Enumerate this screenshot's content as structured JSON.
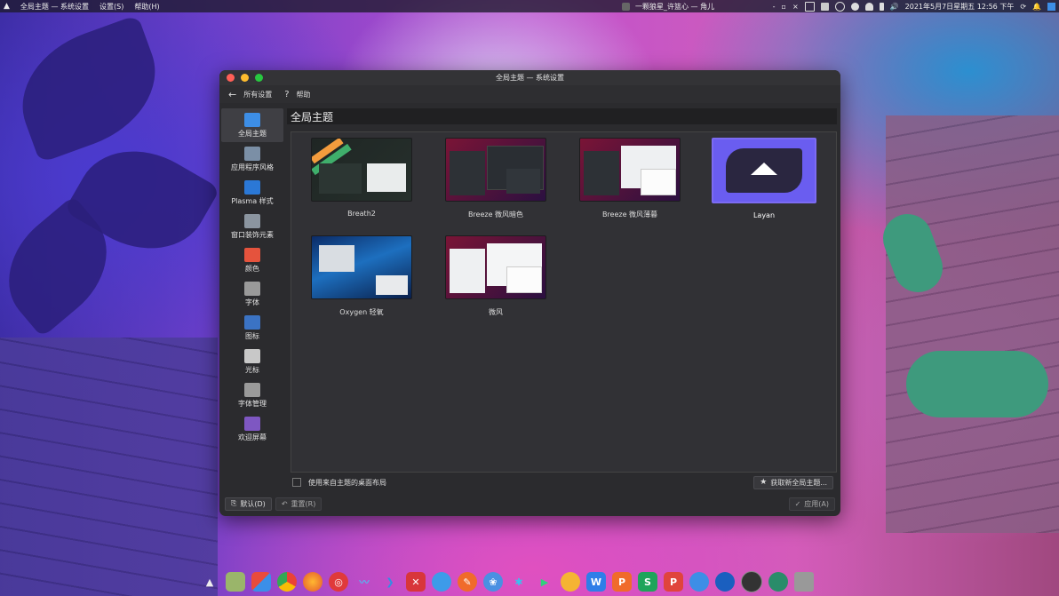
{
  "topbar": {
    "app_name": "全局主题 — 系统设置",
    "menu": [
      "设置(S)",
      "帮助(H)"
    ],
    "now_playing": "一颗狼星_许篮心 — 角儿",
    "datetime": "2021年5月7日星期五|12:56 下午"
  },
  "window": {
    "title": "全局主题 — 系统设置",
    "toolbar": {
      "all_settings": "所有设置",
      "help_glyph": "?",
      "help": "帮助"
    },
    "sidebar": [
      {
        "label": "全局主题",
        "icon": "global-theme-icon",
        "color": "#3d8ee6",
        "active": true
      },
      {
        "label": "应用程序风格",
        "icon": "app-style-icon",
        "color": "#7b8fa6"
      },
      {
        "label": "Plasma 样式",
        "icon": "plasma-style-icon",
        "color": "#2b78d6"
      },
      {
        "label": "窗口装饰元素",
        "icon": "window-decoration-icon",
        "color": "#8b95a0"
      },
      {
        "label": "颜色",
        "icon": "colors-icon",
        "color": "#e5533d"
      },
      {
        "label": "字体",
        "icon": "font-icon",
        "color": "#9a9a9a"
      },
      {
        "label": "图标",
        "icon": "icons-icon",
        "color": "#3b73c4"
      },
      {
        "label": "光标",
        "icon": "cursor-icon",
        "color": "#c8c8c8"
      },
      {
        "label": "字体管理",
        "icon": "font-management-icon",
        "color": "#9a9a9a"
      },
      {
        "label": "欢迎屏幕",
        "icon": "splash-screen-icon",
        "color": "#7e57c2"
      }
    ],
    "heading": "全局主题",
    "themes": [
      {
        "name": "Breath2",
        "selected": false
      },
      {
        "name": "Breeze 微风暗色",
        "selected": false
      },
      {
        "name": "Breeze 微风薄暮",
        "selected": false
      },
      {
        "name": "Layan",
        "selected": true
      },
      {
        "name": "Oxygen 轻氧",
        "selected": false
      },
      {
        "name": "微风",
        "selected": false
      }
    ],
    "use_layout_checkbox": "使用来自主题的桌面布局",
    "get_new": "获取新全局主题...",
    "footer": {
      "defaults": "默认(D)",
      "reset": "重置(R)",
      "apply": "应用(A)"
    }
  },
  "colors": {
    "accent": "#7c6bf2",
    "window_bg": "#2b2b2e"
  }
}
